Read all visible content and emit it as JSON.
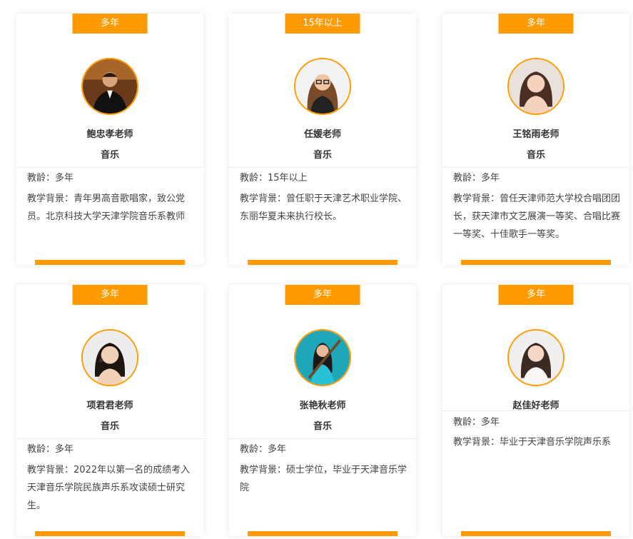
{
  "teachers": [
    {
      "tag": "多年",
      "name": "鲍忠孝老师",
      "subject": "音乐",
      "age": "教龄：多年",
      "background": "教学背景：青年男高音歌唱家，致公党员。北京科技大学天津学院音乐系教师",
      "avatar_icon": "portrait-man-suit-icon"
    },
    {
      "tag": "15年以上",
      "name": "任媛老师",
      "subject": "音乐",
      "age": "教龄：15年以上",
      "background": "教学背景：曾任职于天津艺术职业学院、东丽华夏未来执行校长。",
      "avatar_icon": "portrait-woman-glasses-icon"
    },
    {
      "tag": "多年",
      "name": "王铭雨老师",
      "subject": "音乐",
      "age": "教龄：多年",
      "background": "教学背景：曾任天津师范大学校合唱团团长，获天津市文艺展演一等奖、合唱比赛一等奖、十佳歌手一等奖。",
      "avatar_icon": "portrait-woman-icon"
    },
    {
      "tag": "多年",
      "name": "项君君老师",
      "subject": "音乐",
      "age": "教龄：多年",
      "background": "教学背景：2022年以第一名的成绩考入天津音乐学院民族声乐系攻读硕士研究生。",
      "avatar_icon": "portrait-woman-icon"
    },
    {
      "tag": "多年",
      "name": "张艳秋老师",
      "subject": "音乐",
      "age": "教龄：多年",
      "background": "教学背景：硕士学位，毕业于天津音乐学院",
      "avatar_icon": "portrait-woman-instrument-icon"
    },
    {
      "tag": "多年",
      "name": "赵佳好老师",
      "subject": "",
      "age": "教龄：多年",
      "background": "教学背景：毕业于天津音乐学院声乐系",
      "avatar_icon": "portrait-woman-icon"
    }
  ],
  "colors": {
    "accent": "#ff9a00",
    "text": "#333333"
  }
}
